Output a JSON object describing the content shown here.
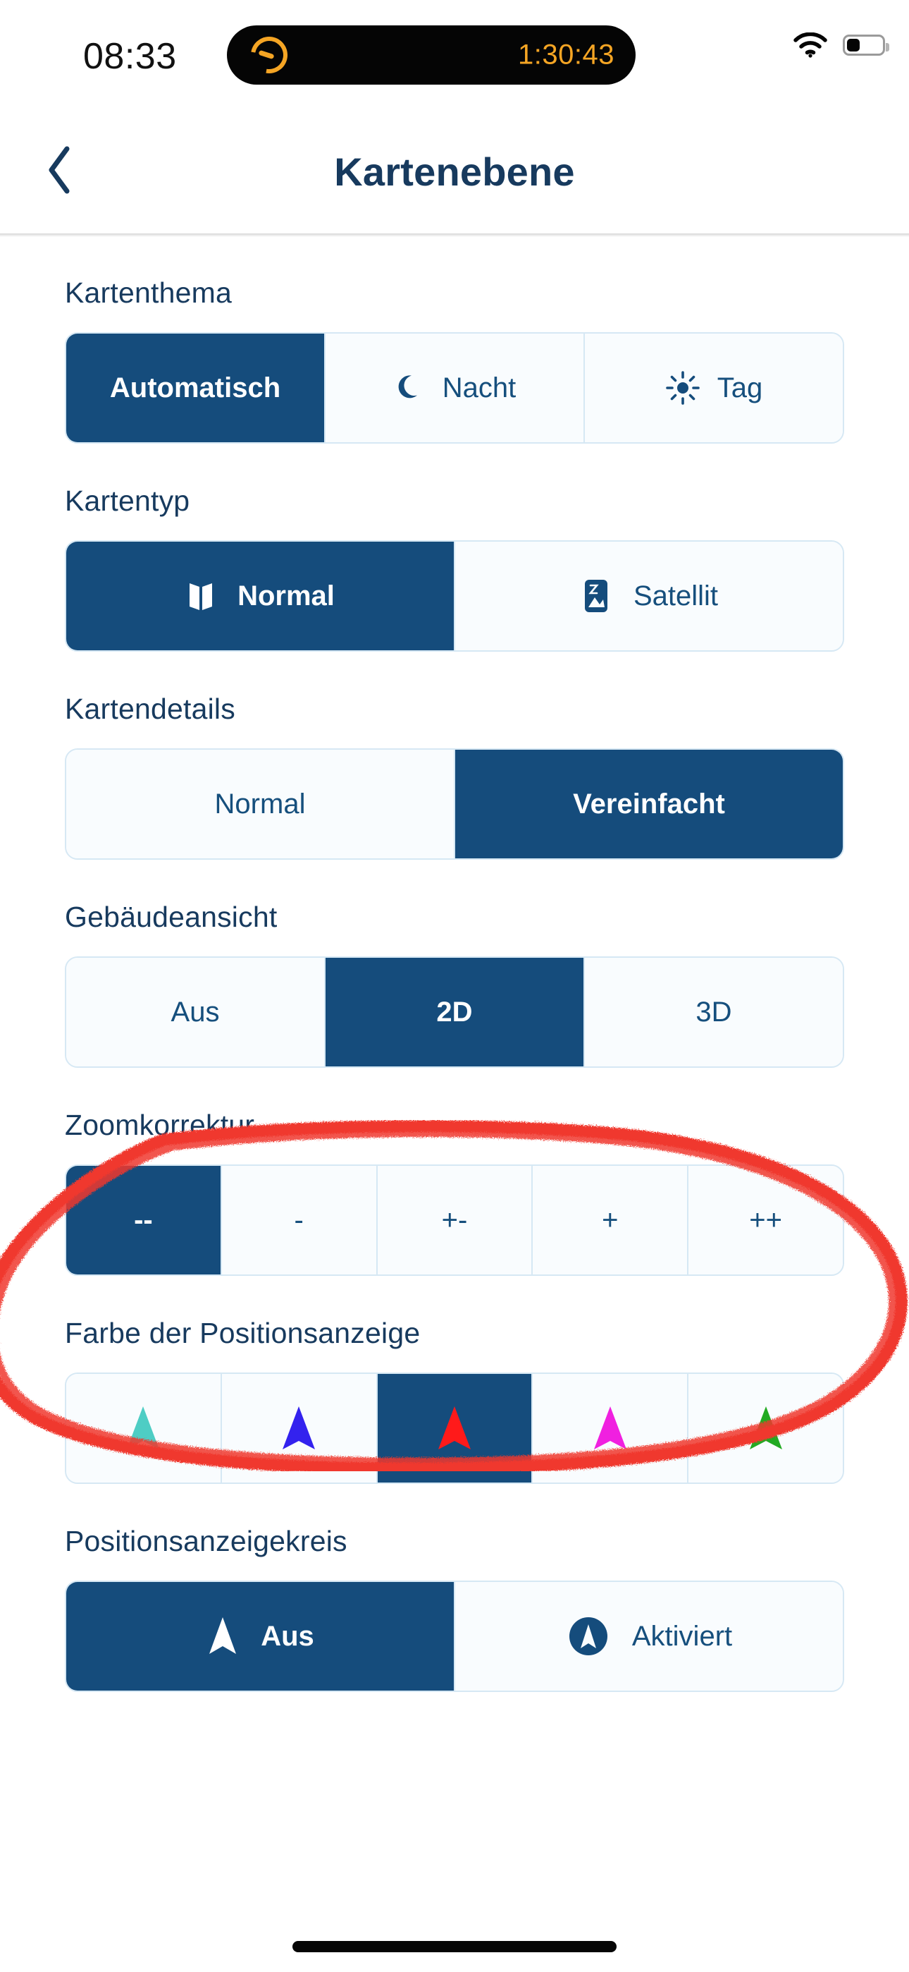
{
  "status_bar": {
    "time": "08:33",
    "timer": "1:30:43",
    "wifi_icon": "wifi-icon",
    "battery_icon": "battery-icon",
    "dynamic_island_icon": "timer-ring-icon"
  },
  "header": {
    "back_icon": "chevron-left-icon",
    "title": "Kartenebene"
  },
  "sections": [
    {
      "key": "map_theme",
      "label": "Kartenthema",
      "options": [
        {
          "label": "Automatisch",
          "icon": null,
          "selected": true
        },
        {
          "label": "Nacht",
          "icon": "moon-icon",
          "selected": false
        },
        {
          "label": "Tag",
          "icon": "sun-icon",
          "selected": false
        }
      ]
    },
    {
      "key": "map_type",
      "label": "Kartentyp",
      "options": [
        {
          "label": "Normal",
          "icon": "map-icon",
          "selected": true
        },
        {
          "label": "Satellit",
          "icon": "satellite-image-icon",
          "selected": false
        }
      ]
    },
    {
      "key": "map_details",
      "label": "Kartendetails",
      "options": [
        {
          "label": "Normal",
          "icon": null,
          "selected": false
        },
        {
          "label": "Vereinfacht",
          "icon": null,
          "selected": true
        }
      ]
    },
    {
      "key": "building_view",
      "label": "Gebäudeansicht",
      "options": [
        {
          "label": "Aus",
          "icon": null,
          "selected": false
        },
        {
          "label": "2D",
          "icon": null,
          "selected": true
        },
        {
          "label": "3D",
          "icon": null,
          "selected": false
        }
      ]
    },
    {
      "key": "zoom_correction",
      "label": "Zoomkorrektur",
      "options": [
        {
          "label": "--",
          "icon": null,
          "selected": true
        },
        {
          "label": "-",
          "icon": null,
          "selected": false
        },
        {
          "label": "+-",
          "icon": null,
          "selected": false
        },
        {
          "label": "+",
          "icon": null,
          "selected": false
        },
        {
          "label": "++",
          "icon": null,
          "selected": false
        }
      ]
    },
    {
      "key": "position_marker_color",
      "label": "Farbe der Positionsanzeige",
      "options": [
        {
          "label": "",
          "icon": "position-arrow-icon",
          "color": "#4ECDC4",
          "selected": false
        },
        {
          "label": "",
          "icon": "position-arrow-icon",
          "color": "#3322EE",
          "selected": false
        },
        {
          "label": "",
          "icon": "position-arrow-icon",
          "color": "#FF1A1A",
          "selected": true
        },
        {
          "label": "",
          "icon": "position-arrow-icon",
          "color": "#F020E0",
          "selected": false
        },
        {
          "label": "",
          "icon": "position-arrow-icon",
          "color": "#22AA22",
          "selected": false
        }
      ]
    },
    {
      "key": "position_marker_circle",
      "label": "Positionsanzeigekreis",
      "options": [
        {
          "label": "Aus",
          "icon": "arrow-plain-icon",
          "selected": true
        },
        {
          "label": "Aktiviert",
          "icon": "arrow-in-circle-icon",
          "selected": false
        }
      ]
    }
  ],
  "annotation": {
    "type": "hand-drawn-ellipse",
    "color": "#F0382F",
    "targets": "Zoomkorrektur"
  },
  "colors": {
    "accent_blue": "#154C7C",
    "text_blue": "#173A5E",
    "border_light": "#D6E8F4",
    "cell_bg": "#F9FCFE",
    "annotation_red": "#F0382F",
    "timer_orange": "#F5A524"
  },
  "home_indicator": "home-bar"
}
